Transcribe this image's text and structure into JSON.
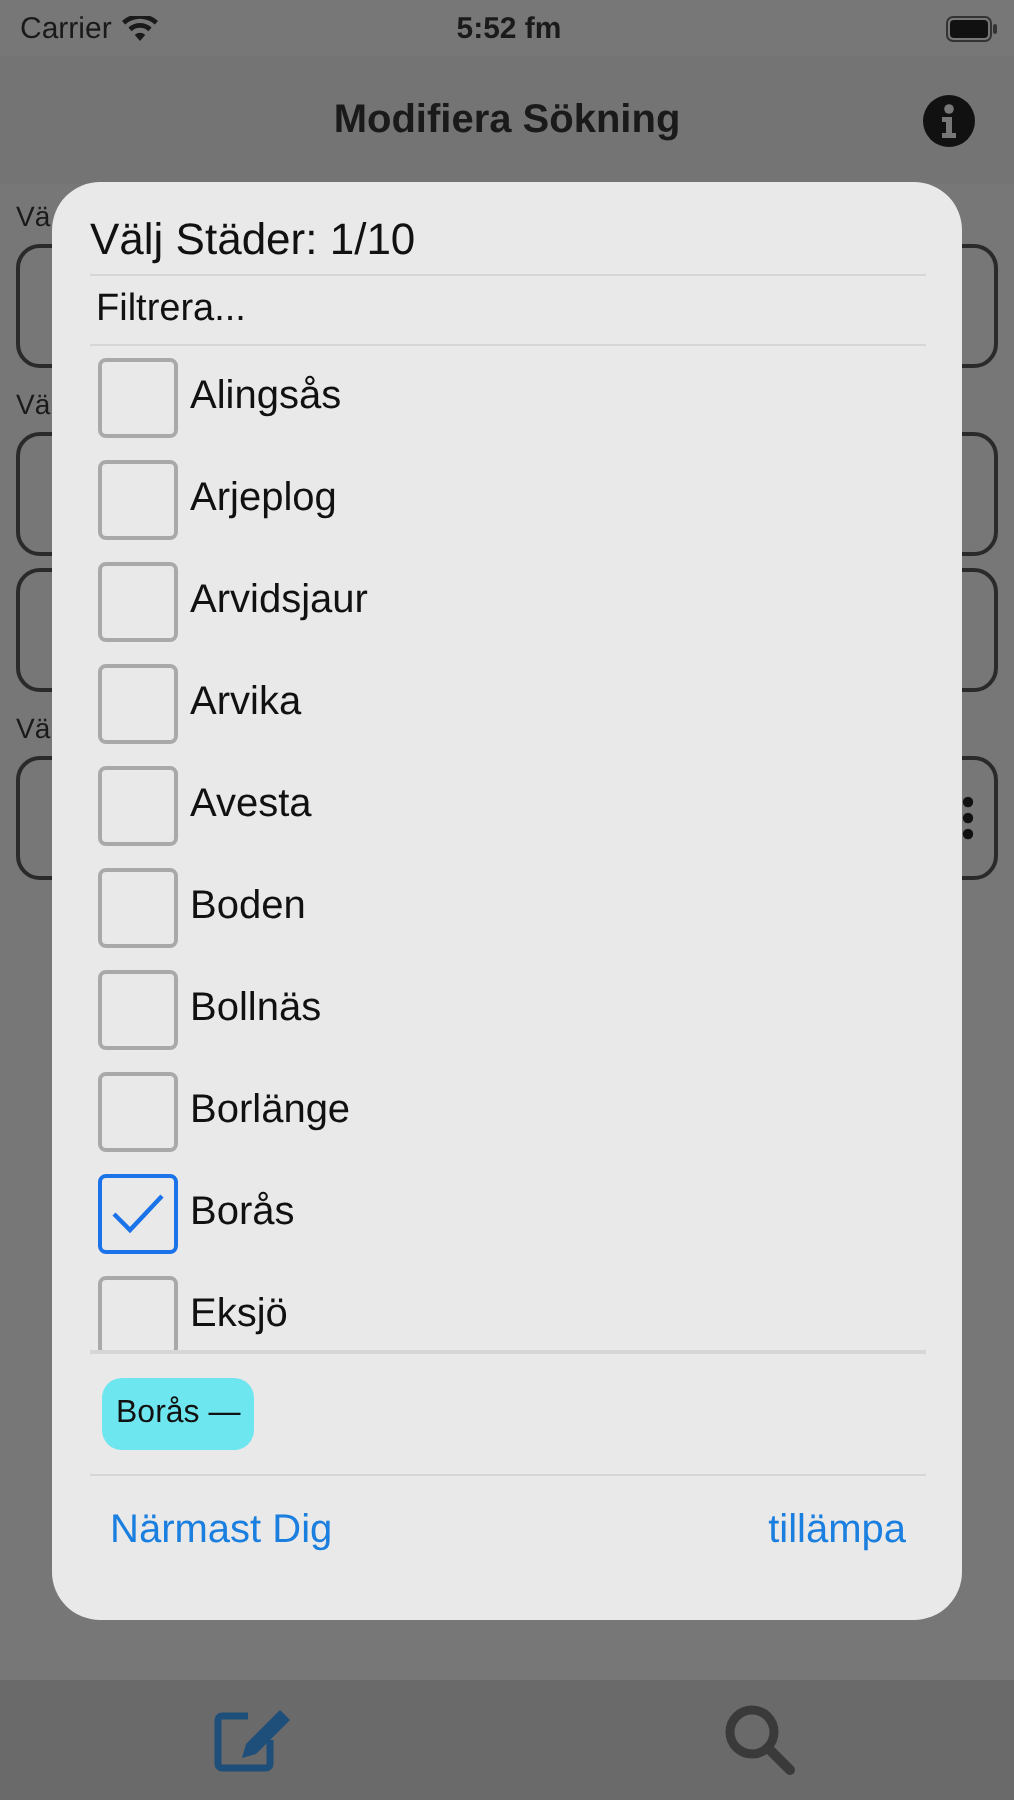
{
  "status_bar": {
    "carrier": "Carrier",
    "time": "5:52 fm"
  },
  "nav_bar": {
    "title": "Modifiera Sökning"
  },
  "background_form": [
    {
      "label": "Vä",
      "fields": [
        {
          "kind": "text"
        }
      ]
    },
    {
      "label": "Vä",
      "fields": [
        {
          "kind": "text"
        },
        {
          "kind": "text"
        }
      ]
    },
    {
      "label": "Vä",
      "fields": [
        {
          "kind": "menu"
        }
      ]
    }
  ],
  "dialog": {
    "title": "Välj Städer: 1/10",
    "filter": {
      "placeholder": "Filtrera..."
    },
    "cities": [
      {
        "name": "Alingsås",
        "checked": false
      },
      {
        "name": "Arjeplog",
        "checked": false
      },
      {
        "name": "Arvidsjaur",
        "checked": false
      },
      {
        "name": "Arvika",
        "checked": false
      },
      {
        "name": "Avesta",
        "checked": false
      },
      {
        "name": "Boden",
        "checked": false
      },
      {
        "name": "Bollnäs",
        "checked": false
      },
      {
        "name": "Borlänge",
        "checked": false
      },
      {
        "name": "Borås",
        "checked": true
      },
      {
        "name": "Eksjö",
        "checked": false
      }
    ],
    "chips": [
      {
        "label": "Borås",
        "remove": "—"
      }
    ],
    "buttons": [
      {
        "label": "Närmast Dig"
      },
      {
        "label": "tillämpa"
      }
    ]
  },
  "tab_bar": [
    {
      "kind": "edit",
      "selected": true
    },
    {
      "kind": "search",
      "selected": false
    }
  ]
}
